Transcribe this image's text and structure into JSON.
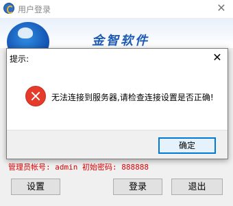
{
  "login": {
    "title": "用户登录",
    "close_glyph": "✕",
    "banner_text": "金智软件",
    "info_text": "管理员帐号: admin  初始密码: 888888",
    "buttons": {
      "settings": "设置",
      "login": "登录",
      "exit": "退出"
    }
  },
  "dialog": {
    "title": "提示:",
    "close_glyph": "✕",
    "message": "无法连接到服务器,请检查连接设置是否正确!",
    "ok_label": "确定",
    "icon": "error-icon"
  },
  "colors": {
    "accent": "#0078d7",
    "error": "#e53b2b",
    "info_text": "#e00000",
    "brand": "#1e5bb5"
  }
}
